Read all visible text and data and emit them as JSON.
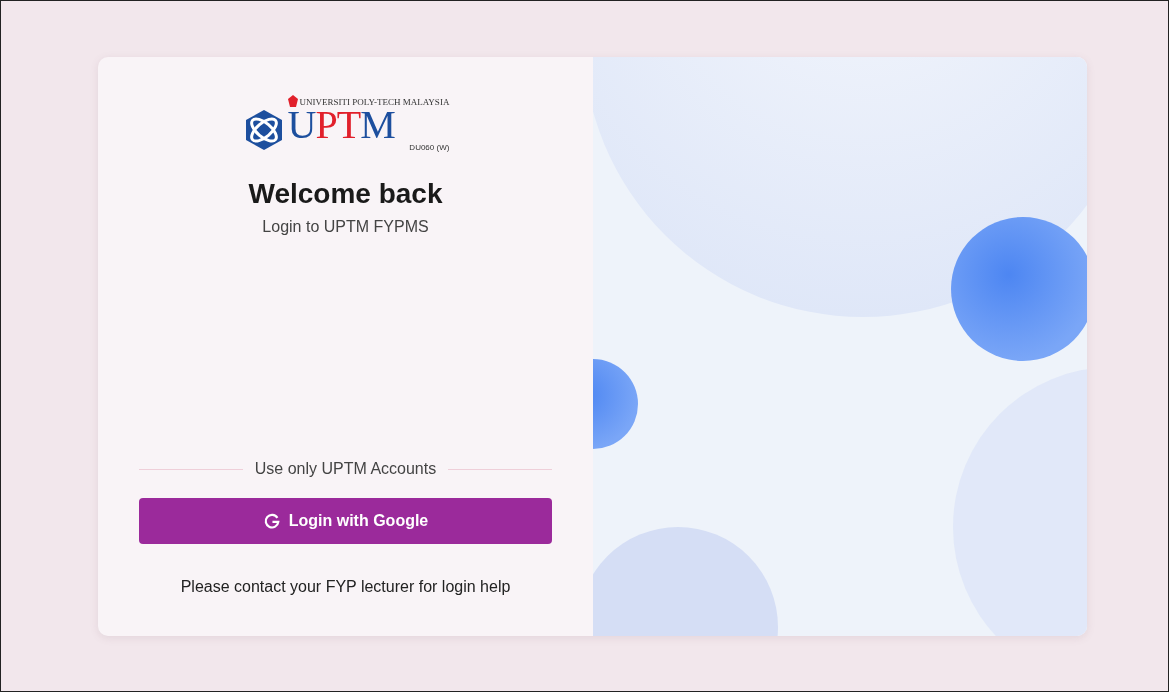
{
  "logo": {
    "tagline": "UNIVERSITI POLY-TECH MALAYSIA",
    "wordmark": [
      {
        "text": "U",
        "color": "#1d4f9e"
      },
      {
        "text": "PT",
        "color": "#e1202b"
      },
      {
        "text": "M",
        "color": "#1d4f9e"
      }
    ],
    "code": "DU060 (W)"
  },
  "heading": "Welcome back",
  "subtitle": "Login to UPTM FYPMS",
  "divider_label": "Use only UPTM Accounts",
  "google_button": {
    "label": "Login with Google"
  },
  "help_text": "Please contact your FYP lecturer for login help"
}
